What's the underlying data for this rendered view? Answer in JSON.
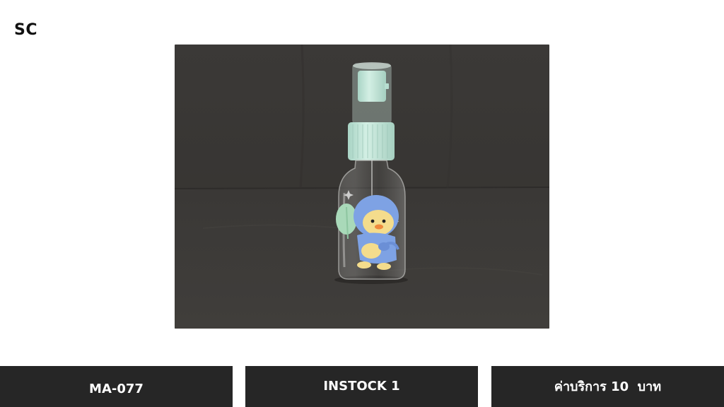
{
  "brand": {
    "logo_text": "SC"
  },
  "product": {
    "image_subject": "clear spray bottle with mint green pump and duck print",
    "code": "MA-077",
    "stock": "INSTOCK 1",
    "service_fee": "ค่าบริการ 10  บาท"
  },
  "colors": {
    "page_background": "#ffffff",
    "tile_background": "#262626",
    "tile_text": "#ffffff",
    "pump_mint": "#bfe3d6",
    "backdrop": "#3a3836"
  }
}
